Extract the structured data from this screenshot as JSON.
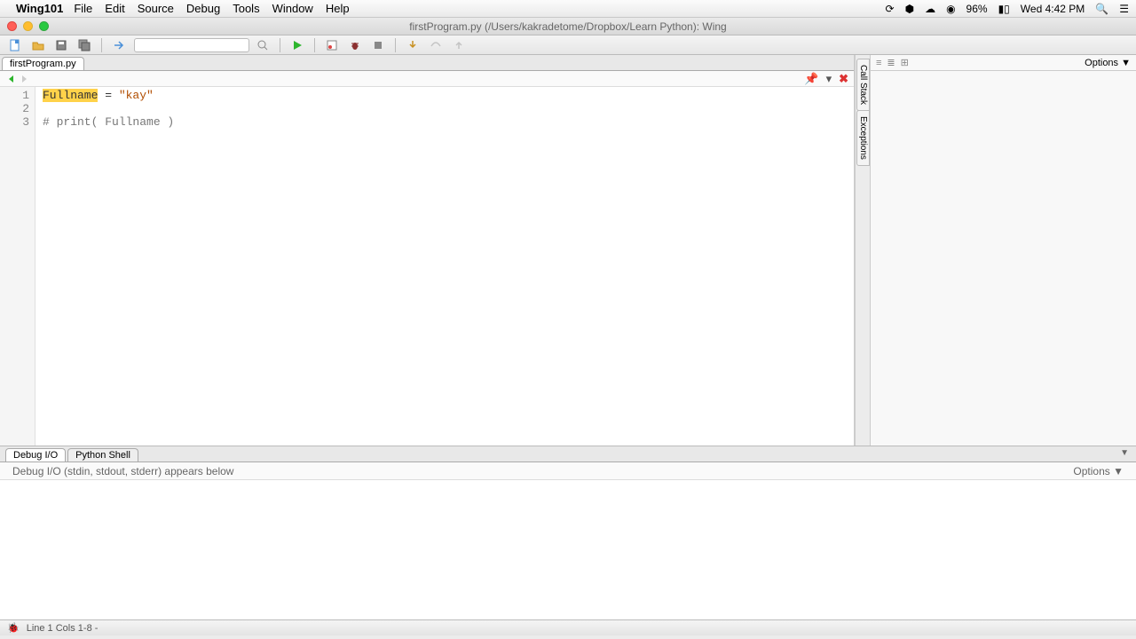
{
  "menubar": {
    "app": "Wing101",
    "items": [
      "File",
      "Edit",
      "Source",
      "Debug",
      "Tools",
      "Window",
      "Help"
    ],
    "battery": "96%",
    "clock": "Wed 4:42 PM"
  },
  "window": {
    "title": "firstProgram.py (/Users/kakradetome/Dropbox/Learn Python): Wing"
  },
  "tabs": {
    "file": "firstProgram.py"
  },
  "code": {
    "lines": [
      "1",
      "2",
      "3"
    ],
    "l1a": "Fullname",
    "l1b": " = ",
    "l1c": "\"kay\"",
    "l2": "",
    "l3": "# print( Fullname )"
  },
  "side": {
    "tab1": "Call Stack",
    "tab2": "Exceptions"
  },
  "right": {
    "options": "Options ▼",
    "icons": [
      "≡",
      "≣",
      "⊞"
    ]
  },
  "bottom": {
    "tab1": "Debug I/O",
    "tab2": "Python Shell",
    "label": "Debug I/O (stdin, stdout, stderr) appears below",
    "options": "Options ▼"
  },
  "status": {
    "text": "Line 1 Cols 1-8 -"
  }
}
